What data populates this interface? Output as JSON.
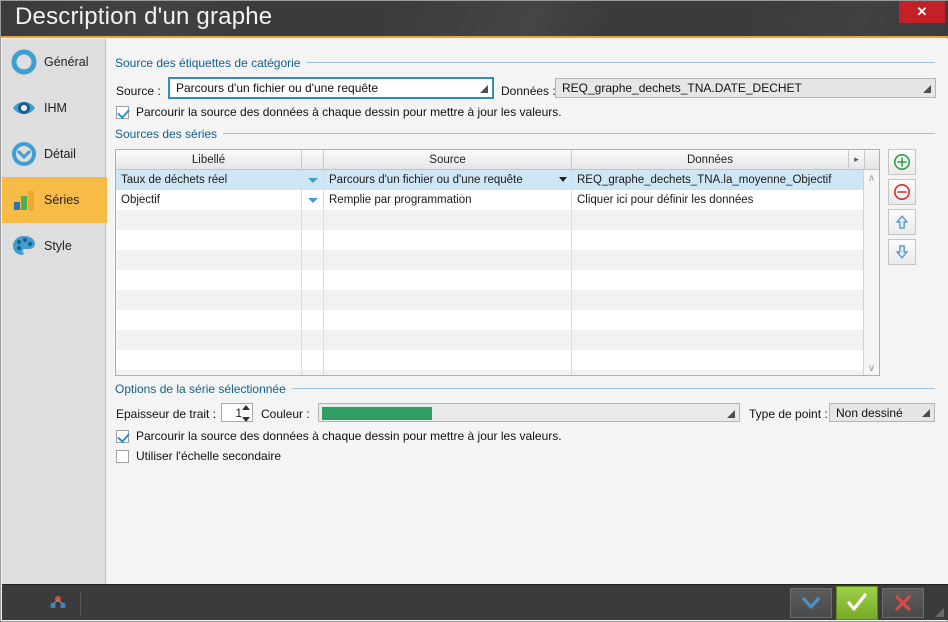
{
  "window": {
    "title": "Description d'un graphe",
    "close_label": "✕"
  },
  "sidebar": {
    "items": [
      {
        "label": "Général",
        "icon": "circle-icon",
        "active": false
      },
      {
        "label": "IHM",
        "icon": "eye-icon",
        "active": false
      },
      {
        "label": "Détail",
        "icon": "chevron-circle-icon",
        "active": false
      },
      {
        "label": "Séries",
        "icon": "bar-chart-icon",
        "active": true
      },
      {
        "label": "Style",
        "icon": "palette-icon",
        "active": false
      }
    ]
  },
  "category_source": {
    "group_title": "Source des étiquettes de catégorie",
    "source_label": "Source :",
    "source_value": "Parcours d'un fichier ou d'une requête",
    "data_label": "Données :",
    "data_value": "REQ_graphe_dechets_TNA.DATE_DECHET",
    "checkbox_label": "Parcourir la source des données à chaque dessin pour mettre à jour les valeurs.",
    "checkbox_checked": true
  },
  "series_sources": {
    "group_title": "Sources des séries",
    "columns": [
      "Libellé",
      "",
      "Source",
      "Données",
      "▸"
    ],
    "rows": [
      {
        "libelle": "Taux de déchets réel",
        "source": "Parcours d'un fichier ou d'une requête",
        "donnees": "REQ_graphe_dechets_TNA.la_moyenne_Objectif",
        "selected": true,
        "source_has_arrow": true
      },
      {
        "libelle": "Objectif",
        "source": "Remplie par programmation",
        "donnees": "Cliquer ici pour définir les données",
        "selected": false,
        "source_has_arrow": false
      }
    ],
    "empty_row_count": 9,
    "tools": [
      {
        "name": "add-series-button",
        "glyph": "⊕",
        "color": "#2e9e4f"
      },
      {
        "name": "remove-series-button",
        "glyph": "⊖",
        "color": "#d03030"
      },
      {
        "name": "move-series-up-button",
        "glyph": "⇧",
        "color": "#4a90c4"
      },
      {
        "name": "move-series-down-button",
        "glyph": "⇩",
        "color": "#4a90c4"
      }
    ],
    "scroll_up": "∧",
    "scroll_down": "∨"
  },
  "series_options": {
    "group_title": "Options de la série sélectionnée",
    "thickness_label": "Epaisseur de trait :",
    "thickness_value": "1",
    "color_label": "Couleur :",
    "color_value": "#2e9e63",
    "point_type_label": "Type de point :",
    "point_type_value": "Non dessiné",
    "checkbox1_label": "Parcourir la source des données à chaque dessin pour mettre à jour les valeurs.",
    "checkbox1_checked": true,
    "checkbox2_label": "Utiliser l'échelle secondaire",
    "checkbox2_checked": false
  },
  "statusbar": {
    "left_icon": "anchor-icon",
    "buttons": [
      {
        "name": "dropdown-button",
        "glyph": "∨",
        "color": "#4a90c4"
      },
      {
        "name": "validate-button",
        "glyph": "✓",
        "color": "#ffffff"
      },
      {
        "name": "cancel-button",
        "glyph": "✕",
        "color": "#d84b44"
      }
    ]
  },
  "theme": {
    "accent": "#e8a33d",
    "title_bg": "#3b3b3b",
    "group_blue": "#11608f",
    "selection_blue": "#cfe7f5",
    "sidebar_active": "#f8bc46",
    "close_red": "#c32027"
  }
}
